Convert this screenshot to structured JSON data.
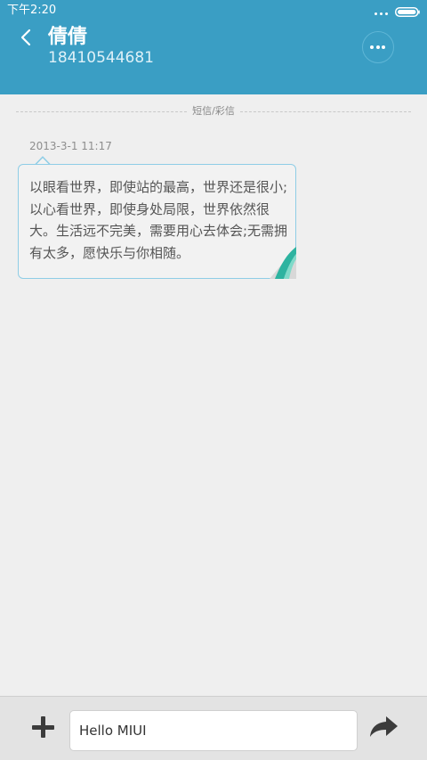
{
  "status_bar": {
    "time": "下午2:20",
    "overflow_icon": "three-dots-icon",
    "battery_icon": "battery-icon"
  },
  "header": {
    "background_color": "#3a9ec4",
    "back_icon": "chevron-left-icon",
    "contact_name": "倩倩",
    "contact_number": "18410544681",
    "more_icon": "more-dots-icon"
  },
  "conversation": {
    "message_type_label": "短信/彩信",
    "messages": [
      {
        "timestamp": "2013-3-1 11:17",
        "text": "以眼看世界，即使站的最高，世界还是很小;以心看世界，即使身处局限，世界依然很大。生活远不完美，需要用心去体会;无需拥有太多，愿快乐与你相随。",
        "bubble_border_color": "#8fcde6"
      }
    ]
  },
  "compose": {
    "add_icon": "plus-icon",
    "input_value": "Hello MIUI",
    "send_icon": "send-arrow-icon"
  }
}
